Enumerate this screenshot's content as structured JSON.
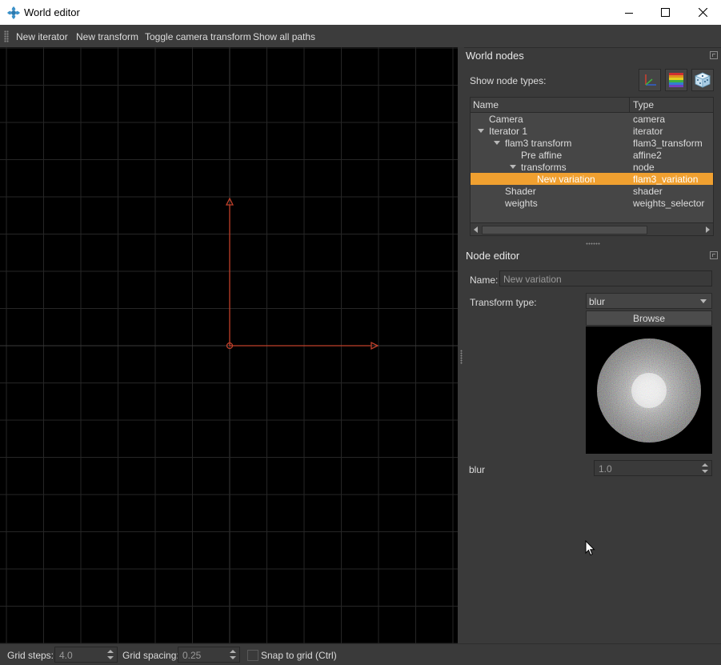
{
  "window": {
    "title": "World editor",
    "icons": {
      "app": "flame-app-icon",
      "minimize": "minimize-icon",
      "maximize": "maximize-icon",
      "close": "close-icon"
    }
  },
  "toolbar": {
    "items": [
      "New iterator",
      "New transform",
      "Toggle camera transform",
      "Show all paths"
    ]
  },
  "world_nodes": {
    "title": "World nodes",
    "show_types_label": "Show node types:",
    "type_buttons": [
      "axis-gizmo-icon",
      "gradient-palette-icon",
      "dice-icon"
    ],
    "columns": {
      "name": "Name",
      "type": "Type"
    },
    "rows": [
      {
        "name": "Camera",
        "type": "camera",
        "depth": 1,
        "expandable": false,
        "selected": false
      },
      {
        "name": "Iterator 1",
        "type": "iterator",
        "depth": 1,
        "expandable": true,
        "selected": false
      },
      {
        "name": "flam3 transform",
        "type": "flam3_transform",
        "depth": 2,
        "expandable": true,
        "selected": false
      },
      {
        "name": "Pre affine",
        "type": "affine2",
        "depth": 3,
        "expandable": false,
        "selected": false
      },
      {
        "name": "transforms",
        "type": "node",
        "depth": 3,
        "expandable": true,
        "selected": false
      },
      {
        "name": "New variation",
        "type": "flam3_variation",
        "depth": 4,
        "expandable": false,
        "selected": true
      },
      {
        "name": "Shader",
        "type": "shader",
        "depth": 2,
        "expandable": false,
        "selected": false
      },
      {
        "name": "weights",
        "type": "weights_selector",
        "depth": 2,
        "expandable": false,
        "selected": false
      }
    ],
    "selection_color": "#f0a030"
  },
  "node_editor": {
    "title": "Node editor",
    "name_label": "Name:",
    "name_value": "New variation",
    "transform_type_label": "Transform type:",
    "transform_type_value": "blur",
    "browse_label": "Browse",
    "param_label": "blur",
    "param_value": "1.0"
  },
  "statusbar": {
    "grid_steps_label": "Grid steps:",
    "grid_steps_value": "4.0",
    "grid_spacing_label": "Grid spacing:",
    "grid_spacing_value": "0.25",
    "snap_label": "Snap to grid (Ctrl)",
    "snap_checked": false
  },
  "viewport": {
    "background": "#000000",
    "grid_color": "#2a2a2a",
    "gizmo_color": "#c0402a"
  }
}
